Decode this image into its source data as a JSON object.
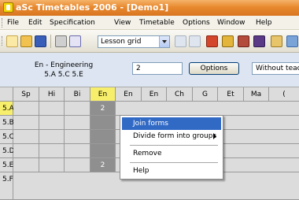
{
  "window": {
    "title": "aSc Timetables 2006  - [Demo1]"
  },
  "menubar": {
    "items": [
      "File",
      "Edit",
      "Specification",
      "View",
      "Timetable",
      "Options",
      "Window",
      "Help"
    ]
  },
  "toolbar": {
    "view_select": "Lesson grid"
  },
  "panel": {
    "lesson_label_1": "En - Engineering",
    "lesson_label_2": "5.A 5.C 5.E",
    "count_value": "2",
    "options_label": "Options",
    "right_field_value": "Without teac"
  },
  "grid": {
    "columns": [
      "Sp",
      "Hi",
      "Bi",
      "En",
      "En",
      "En",
      "Ch",
      "G",
      "Et",
      "Ma",
      "("
    ],
    "rows": [
      "5.A",
      "5.B",
      "5.C",
      "5.D",
      "5.E",
      "5.F"
    ],
    "gray_marker": "2"
  },
  "context_menu": {
    "items": [
      "Join forms",
      "Divide form into groups",
      "Remove",
      "Help"
    ]
  }
}
